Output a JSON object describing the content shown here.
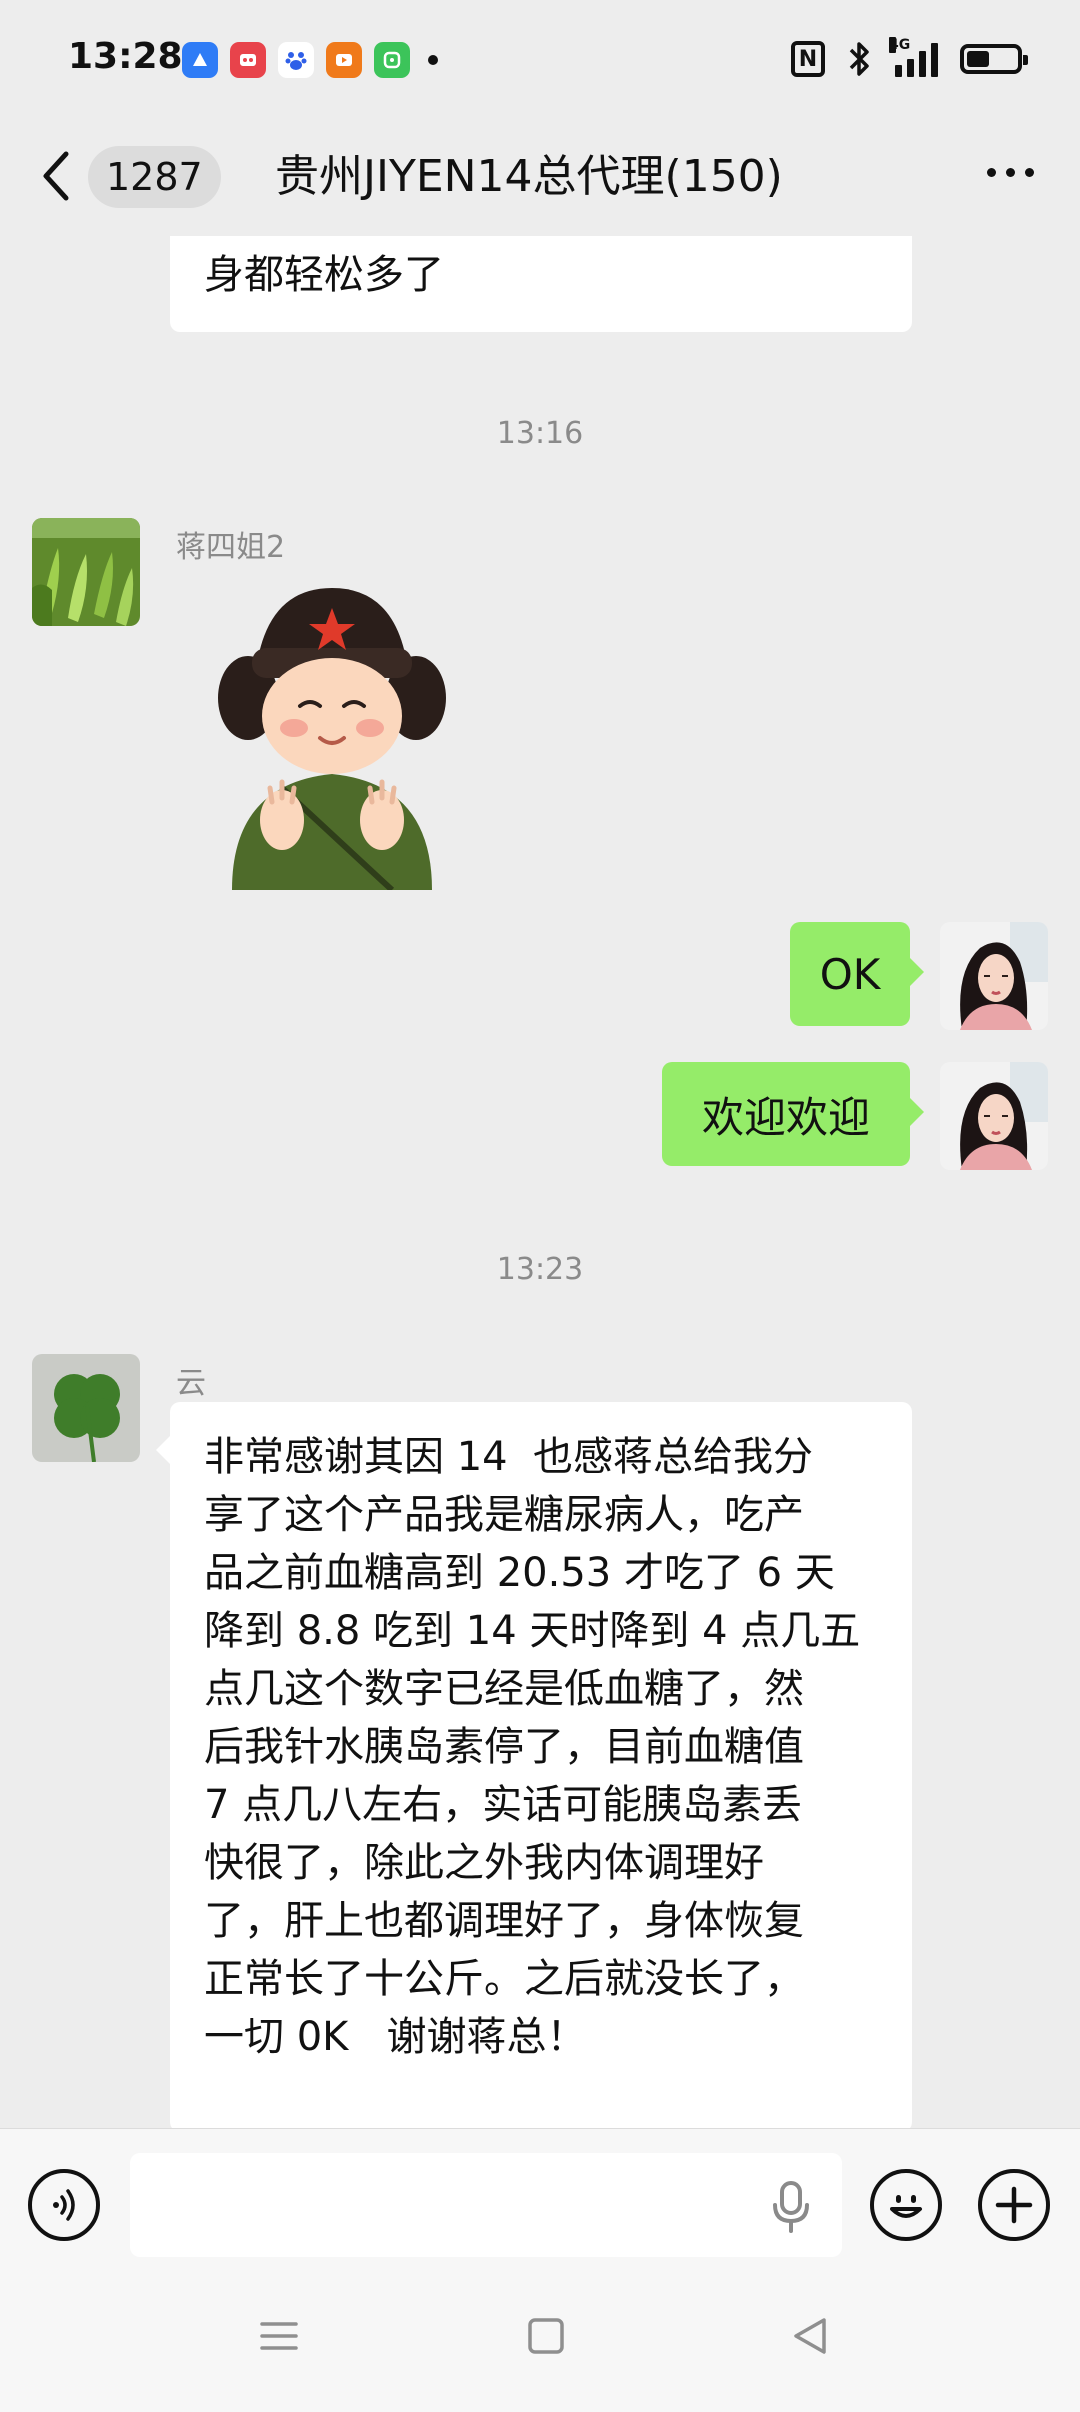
{
  "status_bar": {
    "time": "13:28",
    "apps": [
      {
        "icon": "browser-app-icon",
        "color": "#2f7cf6"
      },
      {
        "icon": "game-app-icon",
        "color": "#e8434b"
      },
      {
        "icon": "baidu-app-icon",
        "color": "#ffffff"
      },
      {
        "icon": "video-app-icon",
        "color": "#f07a1a"
      },
      {
        "icon": "wechat-mini-app-icon",
        "color": "#3cc45a"
      }
    ],
    "network_label": "4G",
    "battery_level": 0.45
  },
  "header": {
    "unread_count": "1287",
    "title": "贵州JIYEN14总代理(150)"
  },
  "messages": {
    "top_fragment": "身都轻松多了",
    "time_1": "13:16",
    "sender_1": "蒋四姐2",
    "reply_ok": "OK",
    "reply_welcome": "欢迎欢迎",
    "time_2": "13:23",
    "sender_2": "云",
    "long_lines": [
      "非常感谢其因 14  也感蒋总给我分",
      "享了这个产品我是糖尿病人，吃产",
      "品之前血糖高到 20.53 才吃了 6 天",
      "降到 8.8 吃到 14 天时降到 4 点几五",
      "点几这个数字已经是低血糖了，然",
      "后我针水胰岛素停了，目前血糖值",
      "7 点几八左右，实话可能胰岛素丢",
      "快很了，除此之外我内体调理好",
      "了，肝上也都调理好了，身体恢复",
      "正常长了十公斤。之后就没长了，",
      "一切 0K   谢谢蒋总！"
    ]
  },
  "colors": {
    "chat_bg": "#ededed",
    "bubble_green": "#95ec69",
    "bubble_white": "#ffffff",
    "meta_gray": "#8a8a8a"
  }
}
